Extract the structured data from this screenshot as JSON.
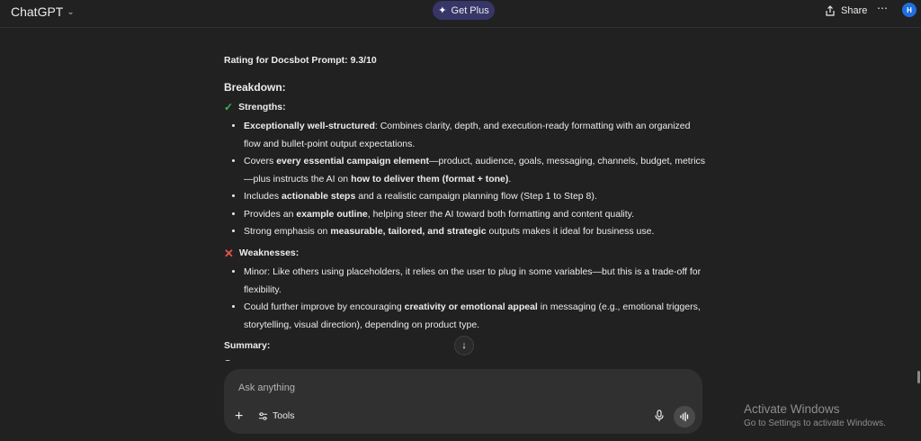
{
  "header": {
    "model_name": "ChatGPT",
    "get_plus_label": "Get Plus",
    "share_label": "Share",
    "more_label": "⋯",
    "avatar_initial": "H"
  },
  "message": {
    "rating": "Rating for Docsbot Prompt: 9.3/10",
    "breakdown_heading": "Breakdown:",
    "strengths_heading": "Strengths:",
    "strengths": [
      {
        "b1": "Exceptionally well-structured",
        "t1": ": Combines clarity, depth, and execution-ready formatting with an organized flow and bullet-point output expectations."
      },
      {
        "t0": "Covers ",
        "b1": "every essential campaign element",
        "t1": "—product, audience, goals, messaging, channels, budget, metrics—plus instructs the AI on ",
        "b2": "how to deliver them (format + tone)",
        "t2": "."
      },
      {
        "t0": "Includes ",
        "b1": "actionable steps",
        "t1": " and a realistic campaign planning flow (Step 1 to Step 8)."
      },
      {
        "t0": "Provides an ",
        "b1": "example outline",
        "t1": ", helping steer the AI toward both formatting and content quality."
      },
      {
        "t0": "Strong emphasis on ",
        "b1": "measurable, tailored, and strategic",
        "t1": " outputs makes it ideal for business use."
      }
    ],
    "weaknesses_heading": "Weaknesses:",
    "weaknesses": [
      {
        "t0": "Minor: Like others using placeholders, it relies on the user to plug in some variables—but this is a trade-off for flexibility."
      },
      {
        "t0": "Could further improve by encouraging ",
        "b1": "creativity or emotional appeal",
        "t1": " in messaging (e.g., emotional triggers, storytelling, visual direction), depending on product type."
      }
    ],
    "summary_heading": "Summary:",
    "summary_cut": "O"
  },
  "composer": {
    "placeholder": "Ask anything",
    "plus_label": "+",
    "tools_label": "Tools"
  },
  "watermark": {
    "title": "Activate Windows",
    "subtitle": "Go to Settings to activate Windows."
  },
  "icons": {
    "check": "check-icon",
    "cross": "cross-icon",
    "mic": "microphone-icon",
    "voice": "voice-mode-icon",
    "share": "share-icon",
    "tools": "sliders-icon",
    "scroll": "arrow-down-icon"
  },
  "colors": {
    "background": "#212121",
    "composer": "#303030",
    "get_plus_bg": "#373669",
    "check": "#3fb950",
    "cross": "#e5534b",
    "avatar": "#1f6fe0"
  }
}
